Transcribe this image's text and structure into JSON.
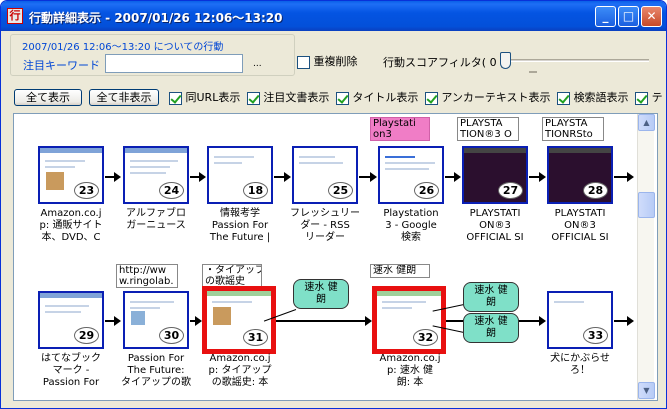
{
  "window": {
    "title": "行動詳細表示 - 2007/01/26  12:06～13:20",
    "app_icon": "行",
    "minimize_glyph": "_",
    "maximize_glyph": "□",
    "close_glyph": "✕"
  },
  "filter_panel": {
    "title": "2007/01/26  12:06～13:20 についての行動",
    "keyword_label": "注目キーワード",
    "keyword_value": "",
    "browse_button": "..."
  },
  "dedupe_label": "重複削除",
  "score_filter": {
    "label": "行動スコアフィルタ( 0 )",
    "value": 0
  },
  "buttons": {
    "show_all": "全て表示",
    "hide_all": "全て非表示"
  },
  "options": [
    {
      "label": "同URL表示",
      "checked": true
    },
    {
      "label": "注目文書表示",
      "checked": true
    },
    {
      "label": "タイトル表示",
      "checked": true
    },
    {
      "label": "アンカーテキスト表示",
      "checked": true
    },
    {
      "label": "検索語表示",
      "checked": true
    },
    {
      "label": "テ",
      "checked": true
    }
  ],
  "row1": {
    "notes": [
      "Playstati\non3",
      "PLAYSTA\nTION®3 O",
      "PLAYSTA\nTIONRSto"
    ],
    "pages": [
      {
        "num": "23",
        "caption": "Amazon.co.j\np: 通販サイト\n本、DVD、C"
      },
      {
        "num": "24",
        "caption": "アルファブロ\nガーニュース"
      },
      {
        "num": "18",
        "caption": "情報考学\nPassion For\nThe Future |"
      },
      {
        "num": "25",
        "caption": "フレッシュリー\nダー - RSS\nリーダー"
      },
      {
        "num": "26",
        "caption": "Playstation\n3 - Google\n検索"
      },
      {
        "num": "27",
        "caption": "PLAYSTATI\nON®3\nOFFICIAL SI"
      },
      {
        "num": "28",
        "caption": "PLAYSTATI\nON®3\nOFFICIAL SI"
      }
    ]
  },
  "row2": {
    "notes": [
      "http://ww\nw.ringolab.",
      "・タイアップ\nの歌謡史",
      "速水 健朗"
    ],
    "bubbles": [
      "速水 健\n朗",
      "速水 健\n朗",
      "速水 健\n朗"
    ],
    "pages": [
      {
        "num": "29",
        "caption": "はてなブック\nマーク -\nPassion For"
      },
      {
        "num": "30",
        "caption": "Passion For\nThe Future:\nタイアップの歌"
      },
      {
        "num": "31",
        "caption": "Amazon.co.j\np: タイアップ\nの歌謡史: 本"
      },
      {
        "num": "32",
        "caption": "Amazon.co.j\np: 速水 健\n朗: 本"
      },
      {
        "num": "33",
        "caption": "犬にかぶらせ\nろ！"
      }
    ]
  },
  "icons": {
    "scroll_up": "▲",
    "scroll_down": "▼"
  }
}
